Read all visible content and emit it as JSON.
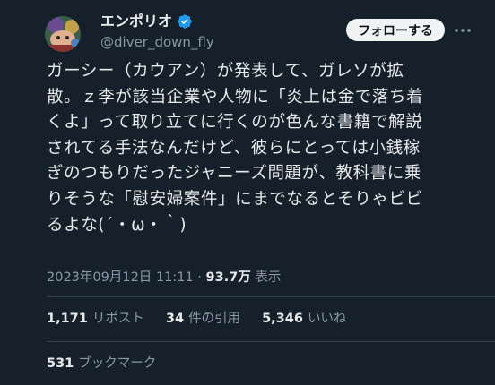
{
  "author": {
    "display_name": "エンポリオ",
    "handle": "@diver_down_fly",
    "verified": true,
    "avatar_icon": "avatar-illustration"
  },
  "follow_button": {
    "label": "フォローする"
  },
  "more_icon": "more-dots-icon",
  "tweet": {
    "lines": [
      "ガーシー（カウアン）が発表して、ガレソが拡",
      "散。ｚ李が該当企業や人物に「炎上は金で落ち着",
      "くよ」って取り立てに行くのが色んな書籍で解説",
      "されてる手法なんだけど、彼らにとっては小銭稼",
      "ぎのつもりだったジャニーズ問題が、教科書に乗",
      "りそうな「慰安婦案件」にまでなるとそりゃビビ",
      "るよな(´・ω・｀)"
    ]
  },
  "meta": {
    "datetime": "2023年09月12日 11:11",
    "separator": " · ",
    "views_count": "93.7万",
    "views_label": " 表示"
  },
  "stats": {
    "retweets_count": "1,171",
    "retweets_label": "リポスト",
    "quotes_count": "34",
    "quotes_label": "件の引用",
    "likes_count": "5,346",
    "likes_label": "いいね"
  },
  "bookmarks": {
    "count": "531",
    "label": "ブックマーク"
  },
  "colors": {
    "background": "#15202b",
    "text": "#e7e9ea",
    "secondary": "#8b98a5",
    "divider": "#38444d",
    "verified": "#1d9bf0",
    "follow_bg": "#eff3f4"
  }
}
